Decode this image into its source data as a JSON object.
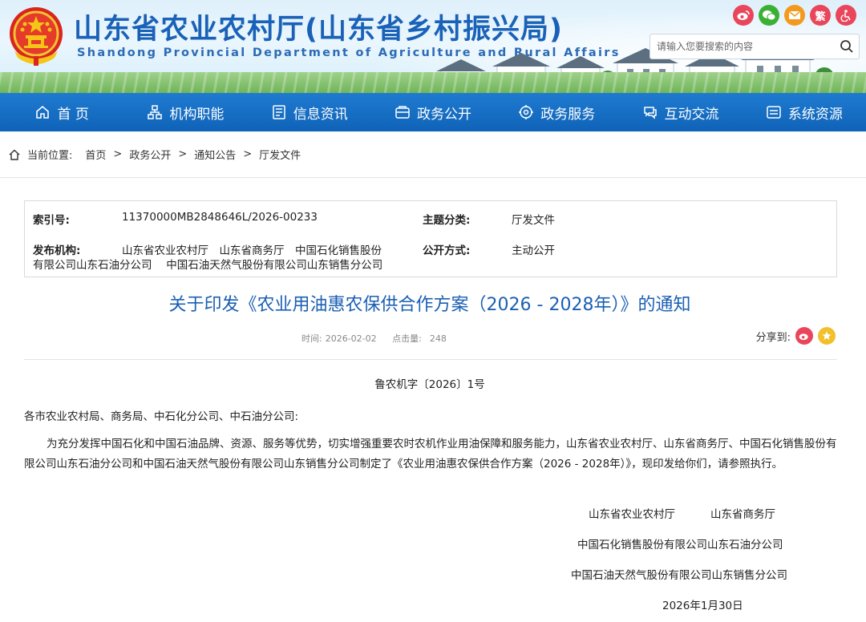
{
  "header": {
    "title": "山东省农业农村厅(山东省乡村振兴局)",
    "subtitle": "Shandong Provincial Department of Agriculture and Rural Affairs",
    "social": {
      "fan_label": "繁"
    },
    "search_placeholder": "请输入您要搜索的内容"
  },
  "nav": [
    {
      "label": "首 页",
      "icon": "home-icon"
    },
    {
      "label": "机构职能",
      "icon": "org-icon"
    },
    {
      "label": "信息资讯",
      "icon": "news-icon"
    },
    {
      "label": "政务公开",
      "icon": "open-icon"
    },
    {
      "label": "政务服务",
      "icon": "service-icon"
    },
    {
      "label": "互动交流",
      "icon": "chat-icon"
    },
    {
      "label": "系统资源",
      "icon": "system-icon"
    }
  ],
  "breadcrumb": {
    "label": "当前位置:",
    "items": [
      "首页",
      "政务公开",
      "通知公告",
      "厅发文件"
    ],
    "separator": ">"
  },
  "meta": {
    "index_label": "索引号:",
    "index_value": "11370000MB2848646L/2026-00233",
    "topic_label": "主题分类:",
    "topic_value": "厅发文件",
    "publisher_label": "发布机构:",
    "publisher_value_line1": "山东省农业农村厅　山东省商务厅　中国石化销售股份",
    "publisher_value_line2": "有限公司山东石油分公司　 中国石油天然气股份有限公司山东销售分公司",
    "disclosure_label": "公开方式:",
    "disclosure_value": "主动公开"
  },
  "article": {
    "title": "关于印发《农业用油惠农保供合作方案（2026 - 2028年）》的通知",
    "time_label": "时间:",
    "time_value": "2026-02-02",
    "clicks_label": "点击量:",
    "clicks_value": "248",
    "share_label": "分享到:",
    "doc_number": "鲁农机字〔2026〕1号",
    "salutation": "各市农业农村局、商务局、中石化分公司、中石油分公司:",
    "body": "为充分发挥中国石化和中国石油品牌、资源、服务等优势，切实增强重要农时农机作业用油保障和服务能力，山东省农业农村厅、山东省商务厅、中国石化销售股份有限公司山东石油分公司和中国石油天然气股份有限公司山东销售分公司制定了《农业用油惠农保供合作方案（2026 - 2028年）》，现印发给你们，请参照执行。",
    "signatures": {
      "line1a": "山东省农业农村厅",
      "line1b": "山东省商务厅",
      "line2": "中国石化销售股份有限公司山东石油分公司",
      "line3": "中国石油天然气股份有限公司山东销售分公司",
      "date": "2026年1月30日"
    }
  },
  "colors": {
    "nav_blue": "#1470c4",
    "title_blue": "#1b5fb3",
    "weibo_red": "#e9465b",
    "wechat_green": "#3cb034",
    "mail_orange": "#f39a1e"
  }
}
